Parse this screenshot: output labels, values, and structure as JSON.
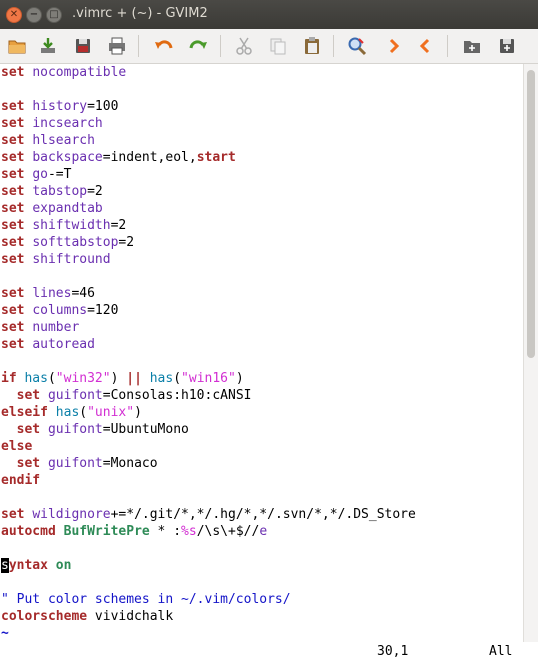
{
  "window": {
    "title": ".vimrc + (~) - GVIM2",
    "close_glyph": "✕",
    "min_glyph": "−",
    "max_glyph": "□"
  },
  "toolbar": {
    "items": [
      {
        "name": "open-icon",
        "color": "#e07b2a"
      },
      {
        "name": "save-icon",
        "color": "#5a8a2a"
      },
      {
        "name": "save-all-icon",
        "color": "#666666"
      },
      {
        "name": "print-icon",
        "color": "#555555"
      },
      {
        "name": "undo-icon",
        "color": "#e06a10"
      },
      {
        "name": "redo-icon",
        "color": "#4a9a2a"
      },
      {
        "name": "cut-icon",
        "color": "#aaaaaa"
      },
      {
        "name": "copy-icon",
        "color": "#aaaaaa"
      },
      {
        "name": "paste-icon",
        "color": "#8a6a3a"
      },
      {
        "name": "find-replace-icon",
        "color": "#3a6ab0"
      },
      {
        "name": "find-next-icon",
        "color": "#f07020"
      },
      {
        "name": "find-prev-icon",
        "color": "#f07020"
      },
      {
        "name": "load-session-icon",
        "color": "#555555"
      },
      {
        "name": "save-session-icon",
        "color": "#555555"
      }
    ]
  },
  "editor": {
    "lines": [
      {
        "tokens": [
          {
            "t": "set",
            "c": "kw"
          },
          {
            "t": " "
          },
          {
            "t": "nocompatible",
            "c": "opt"
          }
        ]
      },
      {
        "tokens": []
      },
      {
        "tokens": [
          {
            "t": "set",
            "c": "kw"
          },
          {
            "t": " "
          },
          {
            "t": "history",
            "c": "opt"
          },
          {
            "t": "=100"
          }
        ]
      },
      {
        "tokens": [
          {
            "t": "set",
            "c": "kw"
          },
          {
            "t": " "
          },
          {
            "t": "incsearch",
            "c": "opt"
          }
        ]
      },
      {
        "tokens": [
          {
            "t": "set",
            "c": "kw"
          },
          {
            "t": " "
          },
          {
            "t": "hlsearch",
            "c": "opt"
          }
        ]
      },
      {
        "tokens": [
          {
            "t": "set",
            "c": "kw"
          },
          {
            "t": " "
          },
          {
            "t": "backspace",
            "c": "opt"
          },
          {
            "t": "=indent,eol,"
          },
          {
            "t": "start",
            "c": "kw"
          }
        ]
      },
      {
        "tokens": [
          {
            "t": "set",
            "c": "kw"
          },
          {
            "t": " "
          },
          {
            "t": "go",
            "c": "opt"
          },
          {
            "t": "-=T"
          }
        ]
      },
      {
        "tokens": [
          {
            "t": "set",
            "c": "kw"
          },
          {
            "t": " "
          },
          {
            "t": "tabstop",
            "c": "opt"
          },
          {
            "t": "=2"
          }
        ]
      },
      {
        "tokens": [
          {
            "t": "set",
            "c": "kw"
          },
          {
            "t": " "
          },
          {
            "t": "expandtab",
            "c": "opt"
          }
        ]
      },
      {
        "tokens": [
          {
            "t": "set",
            "c": "kw"
          },
          {
            "t": " "
          },
          {
            "t": "shiftwidth",
            "c": "opt"
          },
          {
            "t": "=2"
          }
        ]
      },
      {
        "tokens": [
          {
            "t": "set",
            "c": "kw"
          },
          {
            "t": " "
          },
          {
            "t": "softtabstop",
            "c": "opt"
          },
          {
            "t": "=2"
          }
        ]
      },
      {
        "tokens": [
          {
            "t": "set",
            "c": "kw"
          },
          {
            "t": " "
          },
          {
            "t": "shiftround",
            "c": "opt"
          }
        ]
      },
      {
        "tokens": []
      },
      {
        "tokens": [
          {
            "t": "set",
            "c": "kw"
          },
          {
            "t": " "
          },
          {
            "t": "lines",
            "c": "opt"
          },
          {
            "t": "=46"
          }
        ]
      },
      {
        "tokens": [
          {
            "t": "set",
            "c": "kw"
          },
          {
            "t": " "
          },
          {
            "t": "columns",
            "c": "opt"
          },
          {
            "t": "=120"
          }
        ]
      },
      {
        "tokens": [
          {
            "t": "set",
            "c": "kw"
          },
          {
            "t": " "
          },
          {
            "t": "number",
            "c": "opt"
          }
        ]
      },
      {
        "tokens": [
          {
            "t": "set",
            "c": "kw"
          },
          {
            "t": " "
          },
          {
            "t": "autoread",
            "c": "opt"
          }
        ]
      },
      {
        "tokens": []
      },
      {
        "tokens": [
          {
            "t": "if",
            "c": "kw"
          },
          {
            "t": " "
          },
          {
            "t": "has",
            "c": "fn"
          },
          {
            "t": "("
          },
          {
            "t": "\"win32\"",
            "c": "str"
          },
          {
            "t": ") "
          },
          {
            "t": "||",
            "c": "kw"
          },
          {
            "t": " "
          },
          {
            "t": "has",
            "c": "fn"
          },
          {
            "t": "("
          },
          {
            "t": "\"win16\"",
            "c": "str"
          },
          {
            "t": ")"
          }
        ]
      },
      {
        "tokens": [
          {
            "t": "  "
          },
          {
            "t": "set",
            "c": "kw"
          },
          {
            "t": " "
          },
          {
            "t": "guifont",
            "c": "opt"
          },
          {
            "t": "=Consolas:h10:cANSI"
          }
        ]
      },
      {
        "tokens": [
          {
            "t": "elseif",
            "c": "kw"
          },
          {
            "t": " "
          },
          {
            "t": "has",
            "c": "fn"
          },
          {
            "t": "("
          },
          {
            "t": "\"unix\"",
            "c": "str"
          },
          {
            "t": ")"
          }
        ]
      },
      {
        "tokens": [
          {
            "t": "  "
          },
          {
            "t": "set",
            "c": "kw"
          },
          {
            "t": " "
          },
          {
            "t": "guifont",
            "c": "opt"
          },
          {
            "t": "=UbuntuMono"
          }
        ]
      },
      {
        "tokens": [
          {
            "t": "else",
            "c": "kw"
          }
        ]
      },
      {
        "tokens": [
          {
            "t": "  "
          },
          {
            "t": "set",
            "c": "kw"
          },
          {
            "t": " "
          },
          {
            "t": "guifont",
            "c": "opt"
          },
          {
            "t": "=Monaco"
          }
        ]
      },
      {
        "tokens": [
          {
            "t": "endif",
            "c": "kw"
          }
        ]
      },
      {
        "tokens": []
      },
      {
        "tokens": [
          {
            "t": "set",
            "c": "kw"
          },
          {
            "t": " "
          },
          {
            "t": "wildignore",
            "c": "opt"
          },
          {
            "t": "+=*/.git/*,*/.hg/*,*/.svn/*,*/.DS_Store"
          }
        ]
      },
      {
        "tokens": [
          {
            "t": "autocmd",
            "c": "kw"
          },
          {
            "t": " "
          },
          {
            "t": "BufWritePre",
            "c": "gk"
          },
          {
            "t": " * :"
          },
          {
            "t": "%s",
            "c": "str"
          },
          {
            "t": "/\\s\\+$//"
          },
          {
            "t": "e",
            "c": "opt"
          }
        ]
      },
      {
        "tokens": []
      },
      {
        "tokens": [
          {
            "t": "s",
            "c": "cursor"
          },
          {
            "t": "yntax",
            "c": "kw"
          },
          {
            "t": " "
          },
          {
            "t": "on",
            "c": "gk"
          }
        ]
      },
      {
        "tokens": []
      },
      {
        "tokens": [
          {
            "t": "\" Put color schemes in ~/.vim/colors/",
            "c": "cmt"
          }
        ]
      },
      {
        "tokens": [
          {
            "t": "colorscheme",
            "c": "kw"
          },
          {
            "t": " vividchalk"
          }
        ]
      },
      {
        "tokens": [
          {
            "t": "~",
            "c": "tilde"
          }
        ]
      }
    ]
  },
  "statusline": {
    "position": "30,1",
    "percent": "All"
  }
}
